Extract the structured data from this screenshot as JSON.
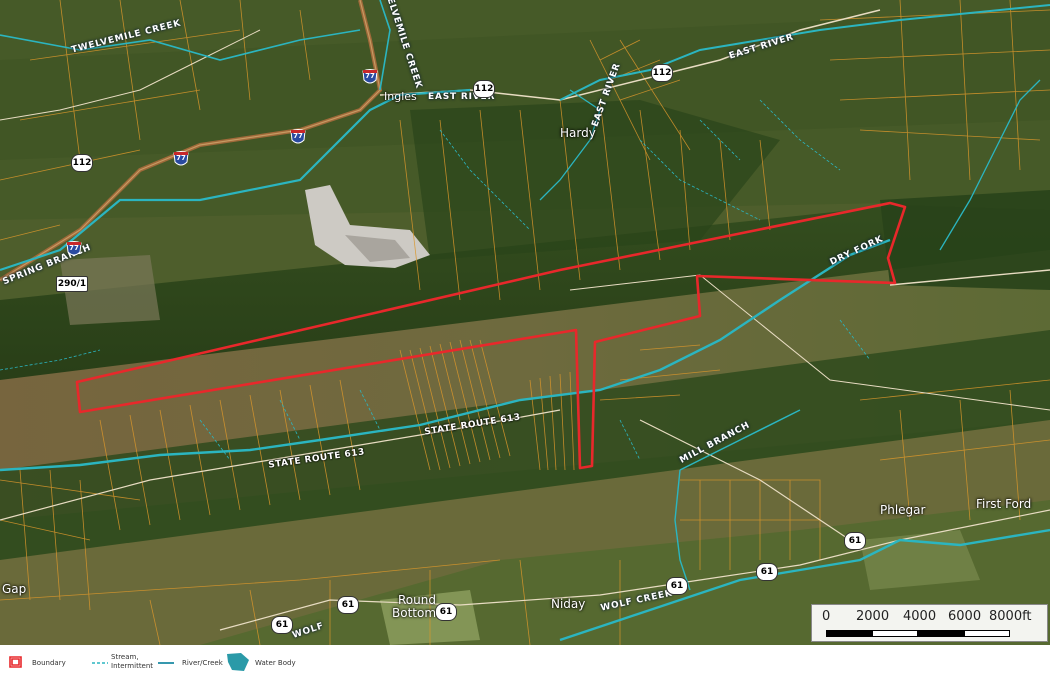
{
  "map": {
    "boundary_color": "#e8282b",
    "parcel_color": "#d9962c",
    "water_color": "#2bb5c0",
    "road_color": "#e8dcc2",
    "interstate_color": "#a06a3a"
  },
  "labels": {
    "twelvemile_creek_top": "TWELVEMILE CREEK",
    "twelvemile_creek_right": "TWELVEMILE CREEK",
    "east_river_road": "EAST RIVER",
    "east_river_creek": "EAST RIVER",
    "inglee": "Ingles",
    "east_river_mid": "EAST RIVER",
    "hardy": "Hardy",
    "spring_branch": "SPRING BRANCH",
    "dry_fork": "DRY FORK",
    "state_route_613_a": "STATE ROUTE 613",
    "state_route_613_b": "STATE ROUTE 613",
    "mill_branch": "MILL BRANCH",
    "phlegar": "Phlegar",
    "first_ford": "First Ford",
    "round_bottom_1": "Round",
    "round_bottom_2": "Bottom",
    "niday": "Niday",
    "wolf_creek_1": "WOLF CREEK",
    "wolf_creek_2": "WOLF",
    "gap": "Gap"
  },
  "shields": {
    "i77_a": "77",
    "i77_b": "77",
    "i77_c": "77",
    "i77_d": "77",
    "sr112_a": "112",
    "sr112_b": "112",
    "sr112_c": "112",
    "sr290": "290/1",
    "sr61_a": "61",
    "sr61_b": "61",
    "sr61_c": "61",
    "sr61_d": "61",
    "sr61_e": "61",
    "sr61_f": "61"
  },
  "scalebar": {
    "ticks": [
      "0",
      "2000",
      "4000",
      "6000",
      "8000ft"
    ]
  },
  "legend": {
    "boundary": "Boundary",
    "stream_line1": "Stream,",
    "stream_line2": "Intermittent",
    "river": "River/Creek",
    "water_body": "Water Body"
  }
}
